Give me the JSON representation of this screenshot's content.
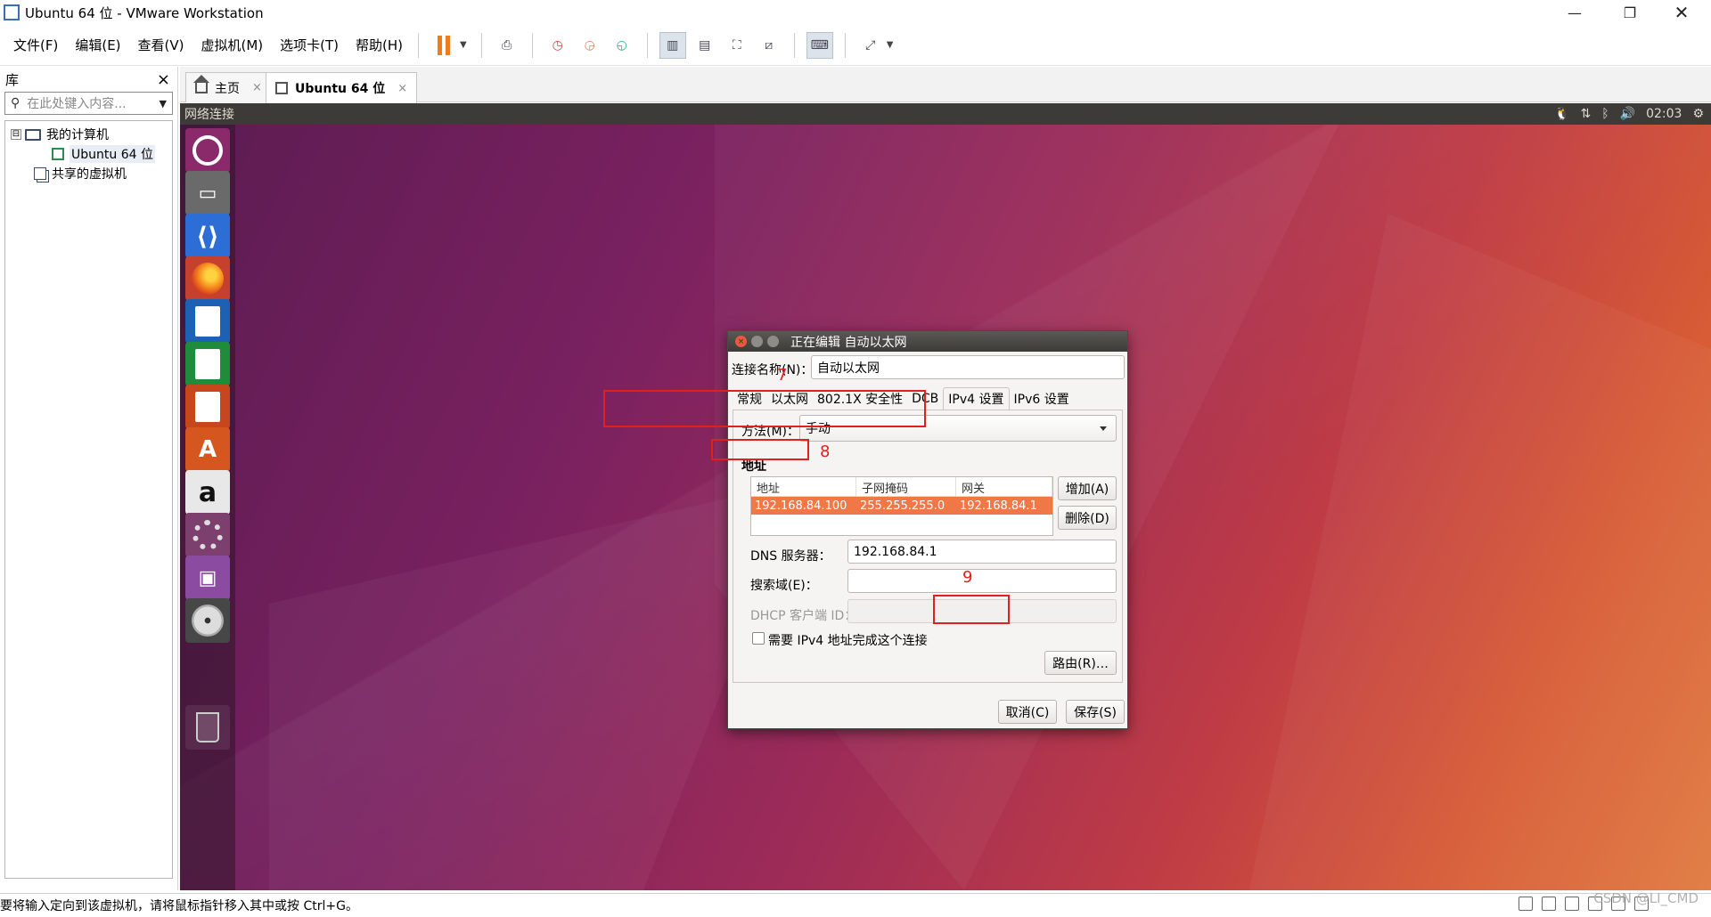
{
  "window": {
    "title": "Ubuntu 64 位 - VMware Workstation",
    "minimize_icon": "minimize-icon",
    "maximize_icon": "restore-icon",
    "close_icon": "close-icon"
  },
  "menu": [
    "文件(F)",
    "编辑(E)",
    "查看(V)",
    "虚拟机(M)",
    "选项卡(T)",
    "帮助(H)"
  ],
  "library": {
    "title": "库",
    "close": "×",
    "search_placeholder": "在此处键入内容...",
    "tree": {
      "root": "我的计算机",
      "vm": "Ubuntu 64 位",
      "shared": "共享的虚拟机",
      "expander": "⊟"
    }
  },
  "tabs": [
    {
      "label": "主页",
      "close": "×"
    },
    {
      "label": "Ubuntu 64 位",
      "close": "×"
    }
  ],
  "guest": {
    "topbar_title": "网络连接",
    "clock": "02:03"
  },
  "dialog": {
    "title": "正在编辑 自动以太网",
    "connection_name_label": "连接名称(N)：",
    "connection_name_value": "自动以太网",
    "tabs": [
      "常规",
      "以太网",
      "802.1X 安全性",
      "DCB",
      "IPv4 设置",
      "IPv6 设置"
    ],
    "active_tab": "IPv4 设置",
    "method_label": "方法(M)：",
    "method_value": "手动",
    "address_section": "地址",
    "address_table": {
      "columns": [
        "地址",
        "子网掩码",
        "网关"
      ],
      "rows": [
        [
          "192.168.84.100",
          "255.255.255.0",
          "192.168.84.1"
        ]
      ]
    },
    "add_button": "增加(A)",
    "delete_button": "删除(D)",
    "dns_label": "DNS 服务器：",
    "dns_value": "192.168.84.1",
    "search_domain_label": "搜索域(E)：",
    "search_domain_value": "",
    "dhcp_id_label": "DHCP 客户端 ID：",
    "dhcp_id_value": "",
    "require_ipv4_label": "需要 IPv4 地址完成这个连接",
    "routes_button": "路由(R)…",
    "cancel_button": "取消(C)",
    "save_button": "保存(S)"
  },
  "annotations": [
    "7",
    "8",
    "9"
  ],
  "annotation_color": "#e02020",
  "statusbar": {
    "message": "要将输入定向到该虚拟机，请将鼠标指针移入其中或按 Ctrl+G。",
    "watermark": "CSDN @LI_CMD"
  }
}
